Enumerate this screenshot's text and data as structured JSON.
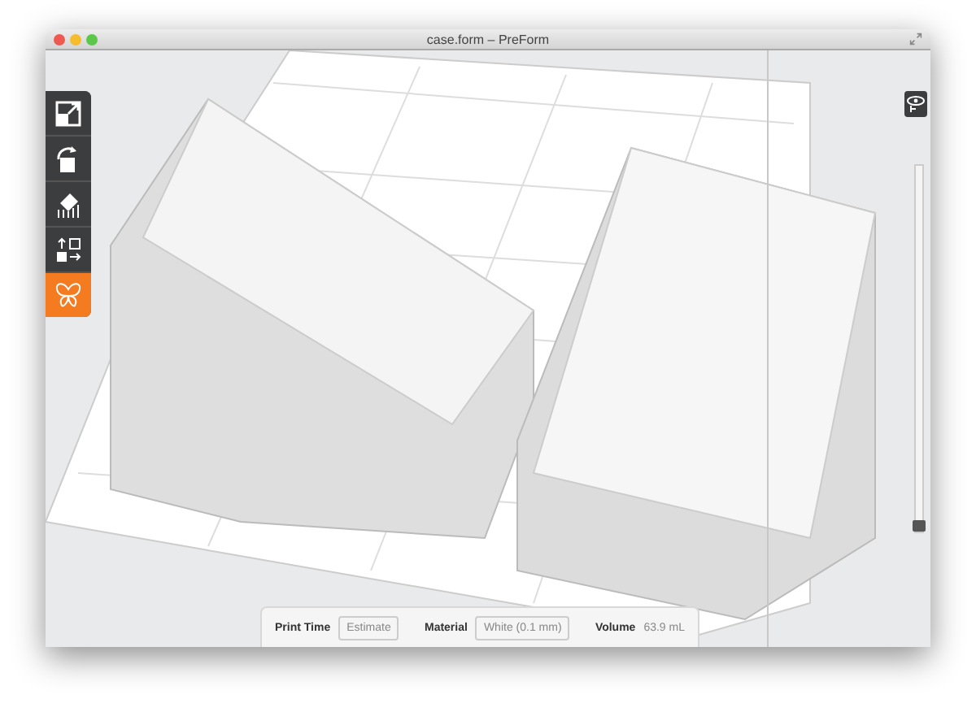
{
  "window": {
    "title": "case.form – PreForm"
  },
  "tools": [
    {
      "kind": "scale",
      "selected": false
    },
    {
      "kind": "rotate",
      "selected": false
    },
    {
      "kind": "supports",
      "selected": false
    },
    {
      "kind": "layout",
      "selected": false
    },
    {
      "kind": "butterfly",
      "selected": true
    }
  ],
  "layer_slider": {
    "level": 0
  },
  "info_bar": {
    "fields": [
      {
        "label": "Print Time",
        "value": "Estimate",
        "kind": "button"
      },
      {
        "label": "Material",
        "value": "White (0.1 mm)",
        "kind": "button"
      },
      {
        "label": "Volume",
        "value": "63.9 mL",
        "kind": "text"
      }
    ]
  }
}
